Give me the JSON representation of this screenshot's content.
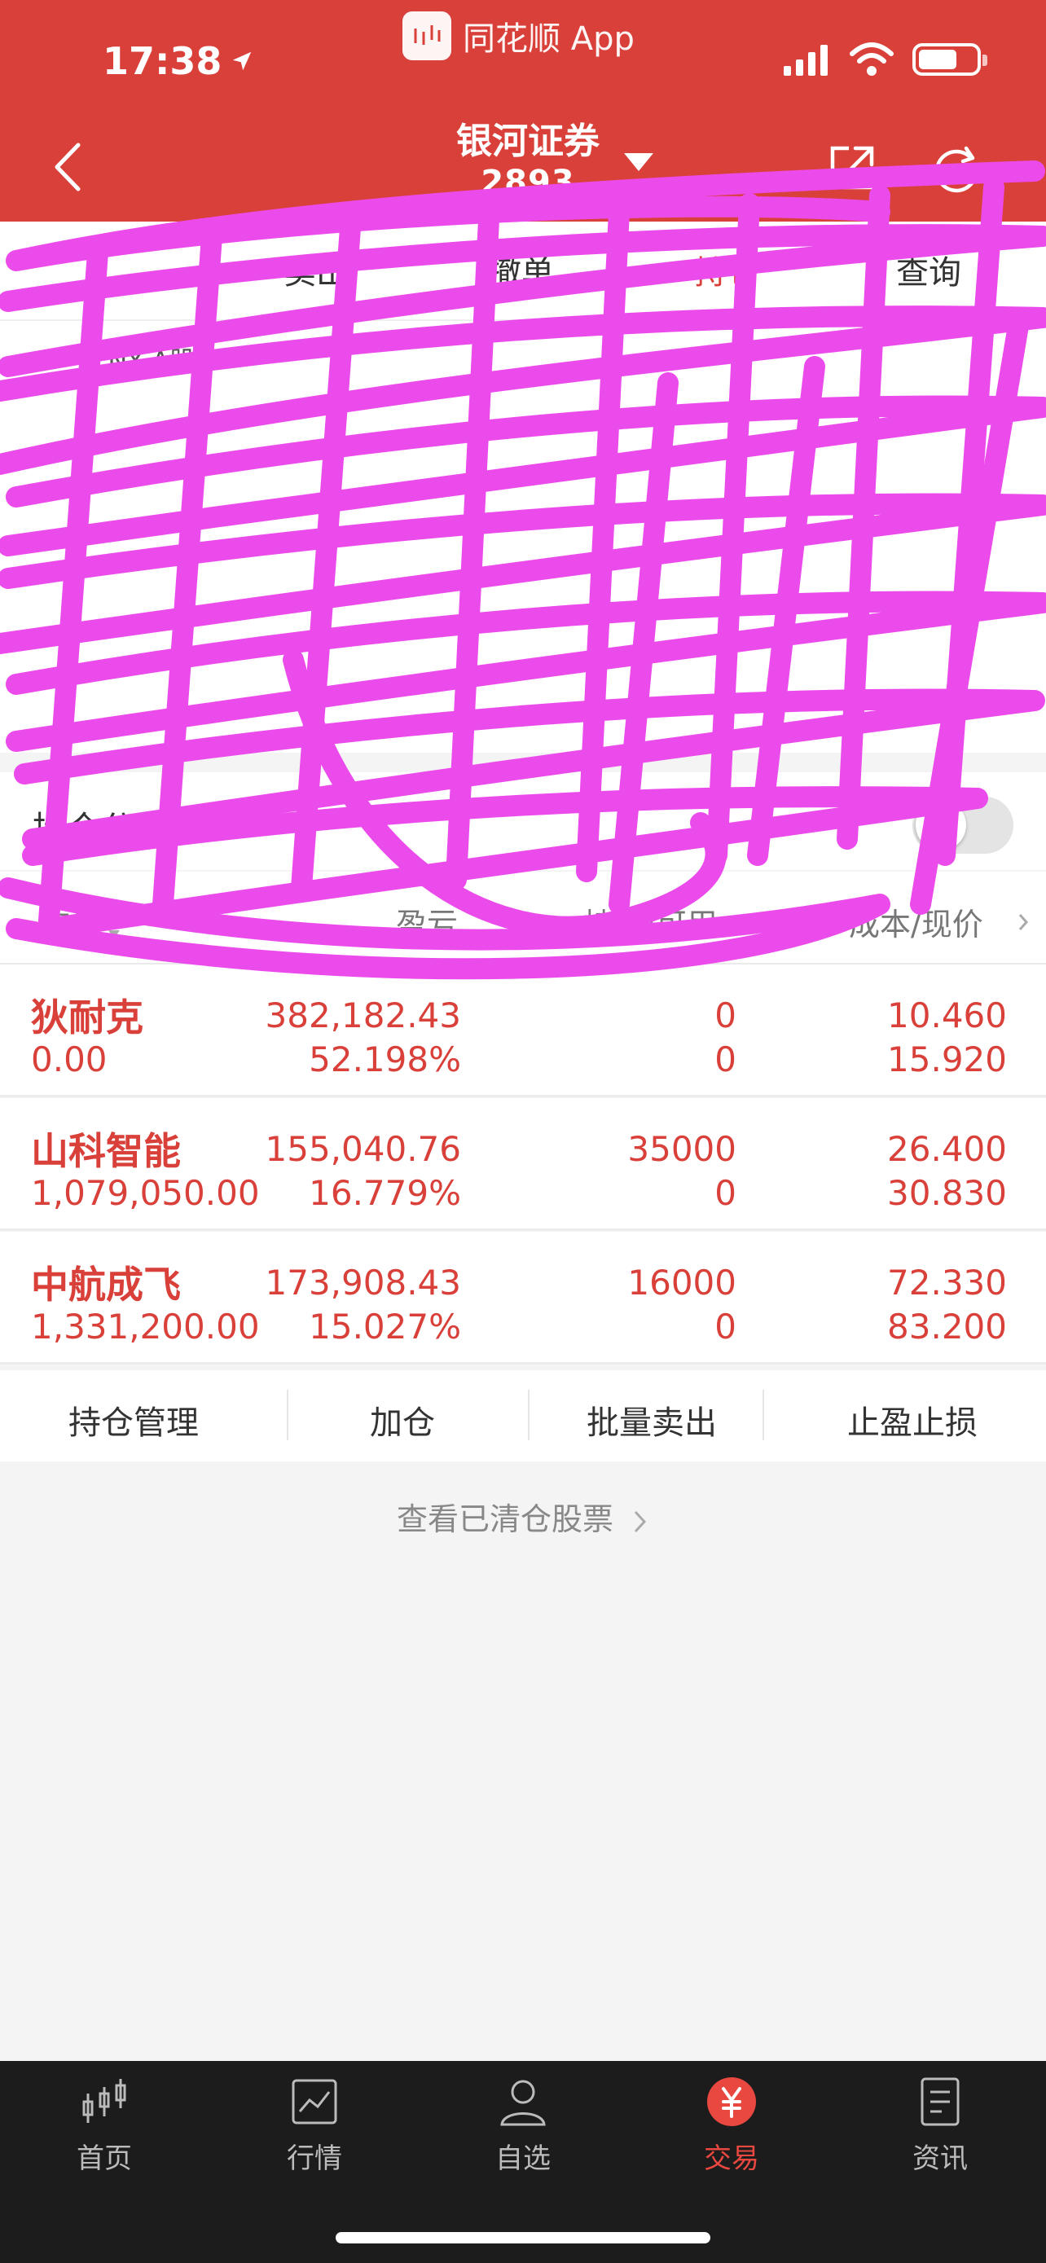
{
  "status_bar": {
    "time": "17:38",
    "app_name": "同花顺 App"
  },
  "header": {
    "broker_name": "银河证券",
    "account": "2893"
  },
  "tabs": [
    "卖出",
    "撤单",
    "持仓",
    "查询"
  ],
  "asset_card": {
    "currency": "CNY A股"
  },
  "toggle_row": {
    "label": "持仓分时"
  },
  "table": {
    "headers": {
      "market_value": "市值",
      "pnl": "盈亏",
      "position": "持仓/可用",
      "cost": "成本/现价"
    },
    "rows": [
      {
        "name": "狄耐克",
        "market_value": "0.00",
        "pnl_amount": "382,182.43",
        "pnl_pct": "52.198%",
        "position": "0",
        "available": "0",
        "cost": "10.460",
        "price": "15.920"
      },
      {
        "name": "山科智能",
        "market_value": "1,079,050.00",
        "pnl_amount": "155,040.76",
        "pnl_pct": "16.779%",
        "position": "35000",
        "available": "0",
        "cost": "26.400",
        "price": "30.830"
      },
      {
        "name": "中航成飞",
        "market_value": "1,331,200.00",
        "pnl_amount": "173,908.43",
        "pnl_pct": "15.027%",
        "position": "16000",
        "available": "0",
        "cost": "72.330",
        "price": "83.200"
      }
    ]
  },
  "actions": [
    "持仓管理",
    "加仓",
    "批量卖出",
    "止盈止损"
  ],
  "cleared_link": "查看已清仓股票",
  "nav": [
    {
      "label": "首页",
      "icon": "candlestick-icon"
    },
    {
      "label": "行情",
      "icon": "chart-icon"
    },
    {
      "label": "自选",
      "icon": "person-icon"
    },
    {
      "label": "交易",
      "icon": "yuan-icon"
    },
    {
      "label": "资讯",
      "icon": "news-icon"
    }
  ],
  "colors": {
    "brand_red": "#d9403a",
    "scribble": "#ec4bec",
    "nav_bg": "#1c1c1c"
  }
}
